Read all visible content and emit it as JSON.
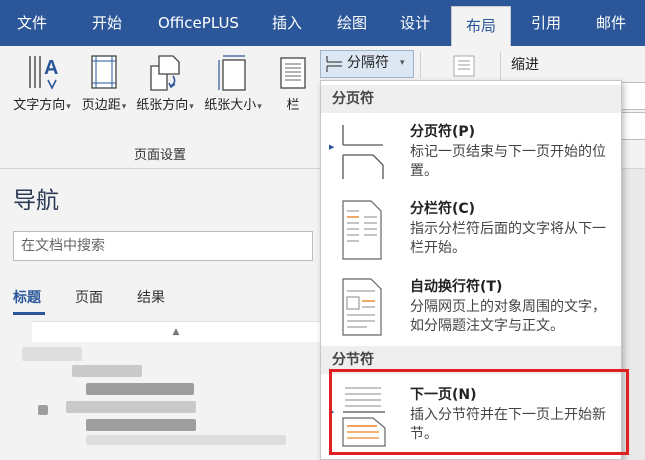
{
  "tabs": [
    {
      "label": "文件"
    },
    {
      "label": "开始"
    },
    {
      "label": "OfficePLUS"
    },
    {
      "label": "插入"
    },
    {
      "label": "绘图"
    },
    {
      "label": "设计"
    },
    {
      "label": "布局"
    },
    {
      "label": "引用"
    },
    {
      "label": "邮件"
    }
  ],
  "ribbon": {
    "page_setup": {
      "buttons": [
        {
          "label": "文字方向",
          "icon": "text-direction-icon"
        },
        {
          "label": "页边距",
          "icon": "margins-icon"
        },
        {
          "label": "纸张方向",
          "icon": "orientation-icon"
        },
        {
          "label": "纸张大小",
          "icon": "page-size-icon"
        },
        {
          "label": "栏",
          "icon": "columns-icon"
        }
      ],
      "group_label": "页面设置"
    },
    "breaks_label": "分隔符",
    "indent_label": "缩进"
  },
  "nav": {
    "title": "导航",
    "search_placeholder": "在文档中搜索",
    "tabs": [
      {
        "label": "标题"
      },
      {
        "label": "页面"
      },
      {
        "label": "结果"
      }
    ]
  },
  "dropdown": {
    "sections": [
      {
        "header": "分页符",
        "items": [
          {
            "title": "分页符(P)",
            "desc": "标记一页结束与下一页开始的位置。",
            "icon": "page-break-icon"
          },
          {
            "title": "分栏符(C)",
            "desc": "指示分栏符后面的文字将从下一栏开始。",
            "icon": "column-break-icon"
          },
          {
            "title": "自动换行符(T)",
            "desc": "分隔网页上的对象周围的文字，如分隔题注文字与正文。",
            "icon": "text-wrapping-icon"
          }
        ]
      },
      {
        "header": "分节符",
        "items": [
          {
            "title": "下一页(N)",
            "desc": "插入分节符并在下一页上开始新节。",
            "icon": "next-page-icon"
          }
        ]
      }
    ]
  },
  "colors": {
    "accent": "#2b579a",
    "highlight": "#e02020",
    "break_marker": "#e8862a"
  }
}
